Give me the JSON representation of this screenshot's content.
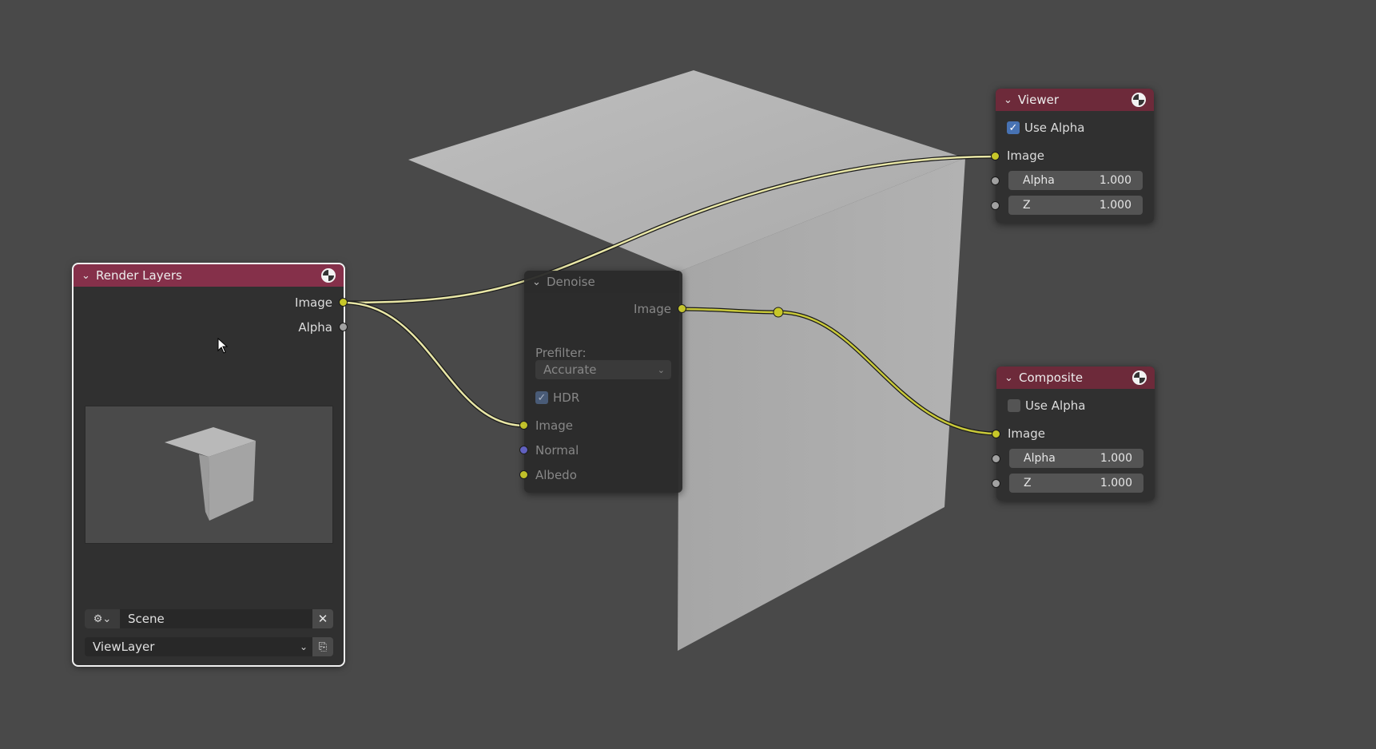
{
  "colors": {
    "background": "#494949",
    "output_header": "#85304a",
    "viewer_header": "#6d2a3a",
    "socket_image": "#c7c729",
    "socket_value": "#a1a1a1",
    "socket_vector": "#6363c7",
    "checkbox_on": "#4772b3"
  },
  "render_layers": {
    "title": "Render Layers",
    "outputs": [
      "Image",
      "Alpha"
    ],
    "scene": "Scene",
    "view_layer": "ViewLayer"
  },
  "denoise": {
    "title": "Denoise",
    "output": "Image",
    "prefilter_label": "Prefilter:",
    "prefilter_value": "Accurate",
    "hdr_label": "HDR",
    "hdr_checked": true,
    "inputs": [
      "Image",
      "Normal",
      "Albedo"
    ]
  },
  "viewer": {
    "title": "Viewer",
    "use_alpha_label": "Use Alpha",
    "use_alpha_checked": true,
    "image_label": "Image",
    "alpha_label": "Alpha",
    "alpha_value": "1.000",
    "z_label": "Z",
    "z_value": "1.000"
  },
  "composite": {
    "title": "Composite",
    "use_alpha_label": "Use Alpha",
    "use_alpha_checked": false,
    "image_label": "Image",
    "alpha_label": "Alpha",
    "alpha_value": "1.000",
    "z_label": "Z",
    "z_value": "1.000"
  },
  "icons": [
    "chevron-down-icon",
    "render-ball-icon",
    "scene-icon",
    "close-icon",
    "view-layer-icon",
    "cursor-icon"
  ]
}
